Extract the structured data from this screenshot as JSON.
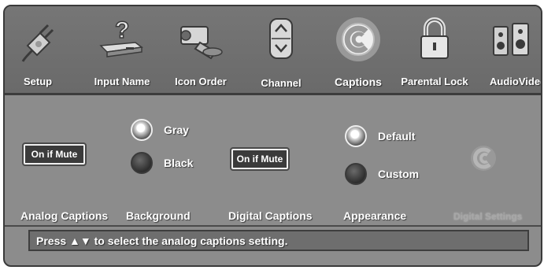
{
  "menu": {
    "items": [
      {
        "label": "Setup",
        "icon": "plug-icon"
      },
      {
        "label": "Input Name",
        "icon": "input-question-icon"
      },
      {
        "label": "Icon Order",
        "icon": "camcorder-icon"
      },
      {
        "label": "Channel",
        "icon": "channel-updown-icon"
      },
      {
        "label": "Captions",
        "icon": "captions-icon"
      },
      {
        "label": "Parental Lock",
        "icon": "lock-icon"
      },
      {
        "label": "AudioVideo",
        "icon": "speaker-icon"
      }
    ],
    "active": "Captions"
  },
  "settings": {
    "analog_captions": {
      "label": "Analog Captions",
      "value": "On if Mute"
    },
    "background": {
      "label": "Background",
      "options": [
        "Gray",
        "Black"
      ],
      "selected": "Gray"
    },
    "digital_captions": {
      "label": "Digital Captions",
      "value": "On if Mute"
    },
    "appearance": {
      "label": "Appearance",
      "options": [
        "Default",
        "Custom"
      ],
      "selected": "Default"
    },
    "digital_settings": {
      "label": "Digital Settings",
      "enabled": false
    }
  },
  "status": {
    "text": "Press ▲▼ to select the analog captions setting."
  },
  "colors": {
    "panel": "#8c8c8c",
    "menu": "#707070",
    "text": "#ffffff",
    "disabled": "#a7a7a7"
  }
}
